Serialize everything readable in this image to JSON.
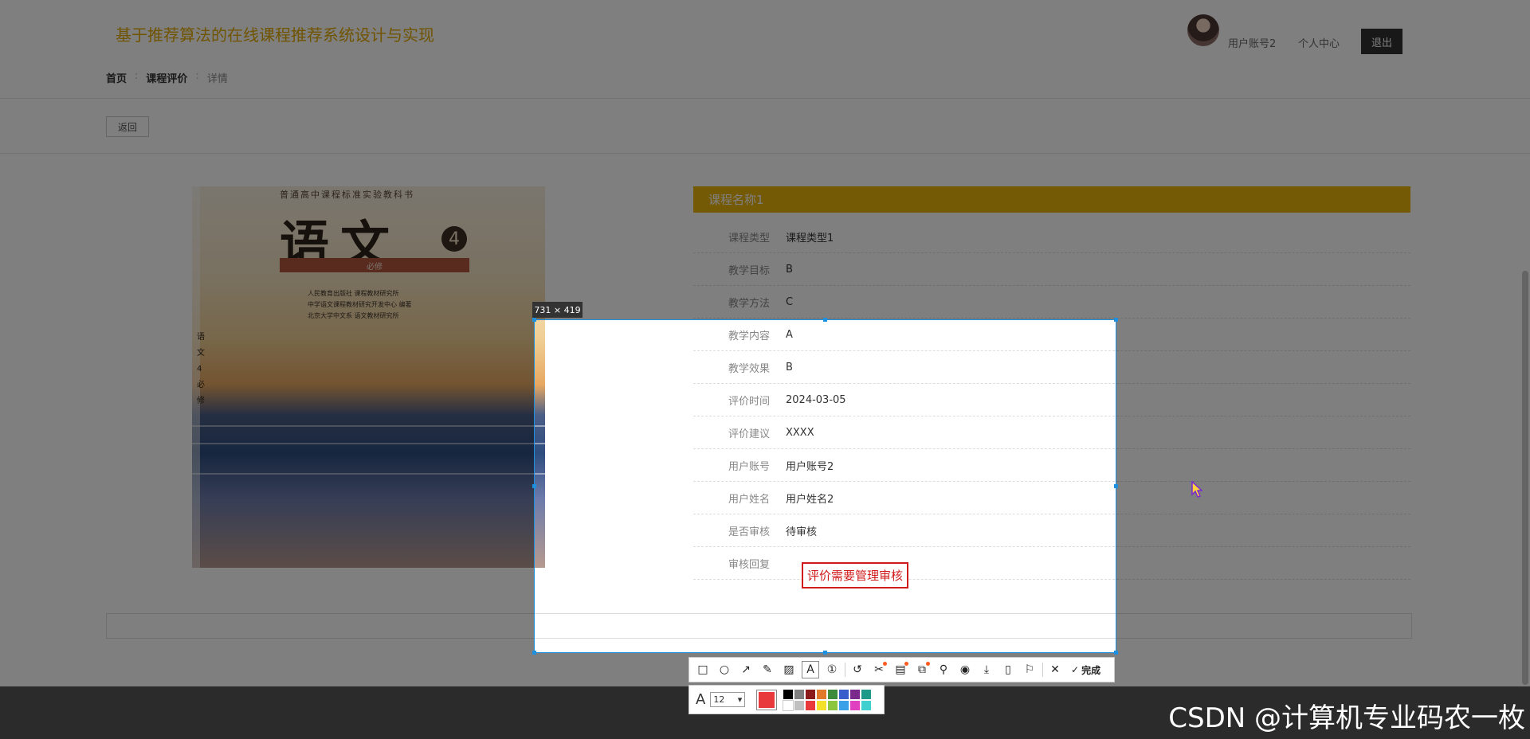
{
  "site": {
    "title": "基于推荐算法的在线课程推荐系统设计与实现",
    "user_name": "用户账号2",
    "profile_link": "个人中心",
    "logout_label": "退出"
  },
  "breadcrumb": {
    "home": "首页",
    "section": "课程评价",
    "current": "详情",
    "separator": ":"
  },
  "back_label": "返回",
  "cover": {
    "series_text": "普通高中课程标准实验教科书",
    "title": "语文",
    "volume": "4",
    "band_text": "必修",
    "publisher_lines": [
      "人民教育出版社  课程教材研究所",
      "中学语文课程教材研究开发中心  编著",
      "北京大学中文系  语文教材研究所"
    ],
    "spine_text": "语文4必修"
  },
  "detail": {
    "course_name": "课程名称1",
    "fields": [
      {
        "label": "课程类型",
        "value": "课程类型1"
      },
      {
        "label": "教学目标",
        "value": "B"
      },
      {
        "label": "教学方法",
        "value": "C"
      },
      {
        "label": "教学内容",
        "value": "A"
      },
      {
        "label": "教学效果",
        "value": "B"
      },
      {
        "label": "评价时间",
        "value": "2024-03-05"
      },
      {
        "label": "评价建议",
        "value": "XXXX"
      },
      {
        "label": "用户账号",
        "value": "用户账号2"
      },
      {
        "label": "用户姓名",
        "value": "用户姓名2"
      },
      {
        "label": "是否审核",
        "value": "待审核"
      },
      {
        "label": "审核回复",
        "value": ""
      }
    ]
  },
  "capture": {
    "size_text": "731 × 419",
    "annotation_text": "评价需要管理审核",
    "annotation_color": "#d11a1a",
    "frame_color": "#1e90e0"
  },
  "toolbar": {
    "tools": [
      {
        "name": "rectangle-tool",
        "glyph": "□"
      },
      {
        "name": "ellipse-tool",
        "glyph": "○"
      },
      {
        "name": "arrow-tool",
        "glyph": "↗"
      },
      {
        "name": "pen-tool",
        "glyph": "✎"
      },
      {
        "name": "mosaic-tool",
        "glyph": "▨"
      },
      {
        "name": "text-tool",
        "glyph": "A"
      },
      {
        "name": "number-tool",
        "glyph": "①"
      },
      {
        "name": "undo-tool",
        "glyph": "↺"
      },
      {
        "name": "cutout-tool",
        "glyph": "✂"
      },
      {
        "name": "ocr-tool",
        "glyph": "▤"
      },
      {
        "name": "translate-tool",
        "glyph": "⧉"
      },
      {
        "name": "pin-tool",
        "glyph": "⚲"
      },
      {
        "name": "record-tool",
        "glyph": "◉"
      },
      {
        "name": "download-tool",
        "glyph": "⤓"
      },
      {
        "name": "long-capture-tool",
        "glyph": "▯"
      },
      {
        "name": "bookmark-tool",
        "glyph": "⚐"
      },
      {
        "name": "close-tool",
        "glyph": "✕"
      }
    ],
    "done_label": "完成",
    "done_glyph": "✓",
    "font_label": "A",
    "font_size": "12",
    "current_color": "#e8393c",
    "palette": [
      "#000000",
      "#808080",
      "#8b1a1a",
      "#e07a2a",
      "#3c8a3c",
      "#3a5fcd",
      "#7a2a8a",
      "#1e9a8a",
      "#ffffff",
      "#c0c0c0",
      "#e8393c",
      "#f2e02a",
      "#8cc63f",
      "#3aa0e8",
      "#e040c0",
      "#40d0d0"
    ]
  },
  "watermark": "CSDN @计算机专业码农一枚"
}
